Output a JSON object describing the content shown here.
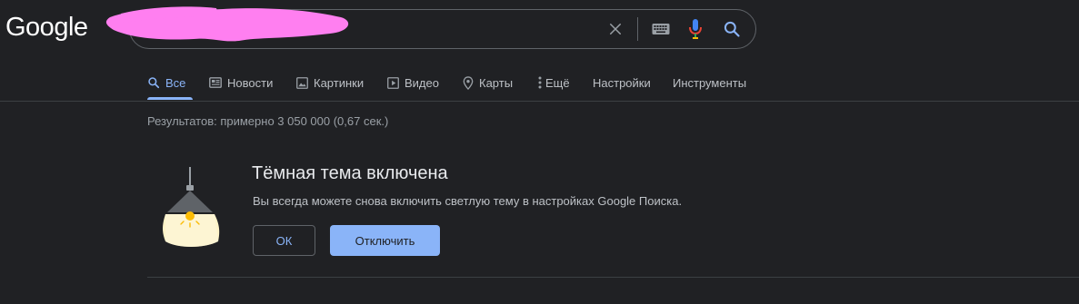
{
  "header": {
    "logo_text": "Google",
    "search": {
      "value": "",
      "redacted": true,
      "redaction_color": "#ff7ff0"
    },
    "icons": {
      "clear": "close-icon",
      "keyboard": "keyboard-icon",
      "voice": "microphone-icon",
      "search": "search-icon"
    }
  },
  "tabs": [
    {
      "label": "Все",
      "icon": "search-icon",
      "active": true
    },
    {
      "label": "Новости",
      "icon": "news-icon",
      "active": false
    },
    {
      "label": "Картинки",
      "icon": "image-icon",
      "active": false
    },
    {
      "label": "Видео",
      "icon": "video-icon",
      "active": false
    },
    {
      "label": "Карты",
      "icon": "map-pin-icon",
      "active": false
    },
    {
      "label": "Ещё",
      "icon": "more-vert-icon",
      "active": false
    },
    {
      "label": "Настройки",
      "icon": "",
      "active": false
    },
    {
      "label": "Инструменты",
      "icon": "",
      "active": false
    }
  ],
  "results": {
    "stats": "Результатов: примерно 3 050 000 (0,67 сек.)"
  },
  "dark_theme_notice": {
    "title": "Тёмная тема включена",
    "subtitle": "Вы всегда можете снова включить светлую тему в настройках Google Поиска.",
    "ok_label": "ОК",
    "disable_label": "Отключить"
  },
  "colors": {
    "background": "#202124",
    "accent": "#8ab4f8",
    "text_primary": "#e8eaed",
    "text_secondary": "#bdc1c6",
    "border": "#5f6368"
  }
}
